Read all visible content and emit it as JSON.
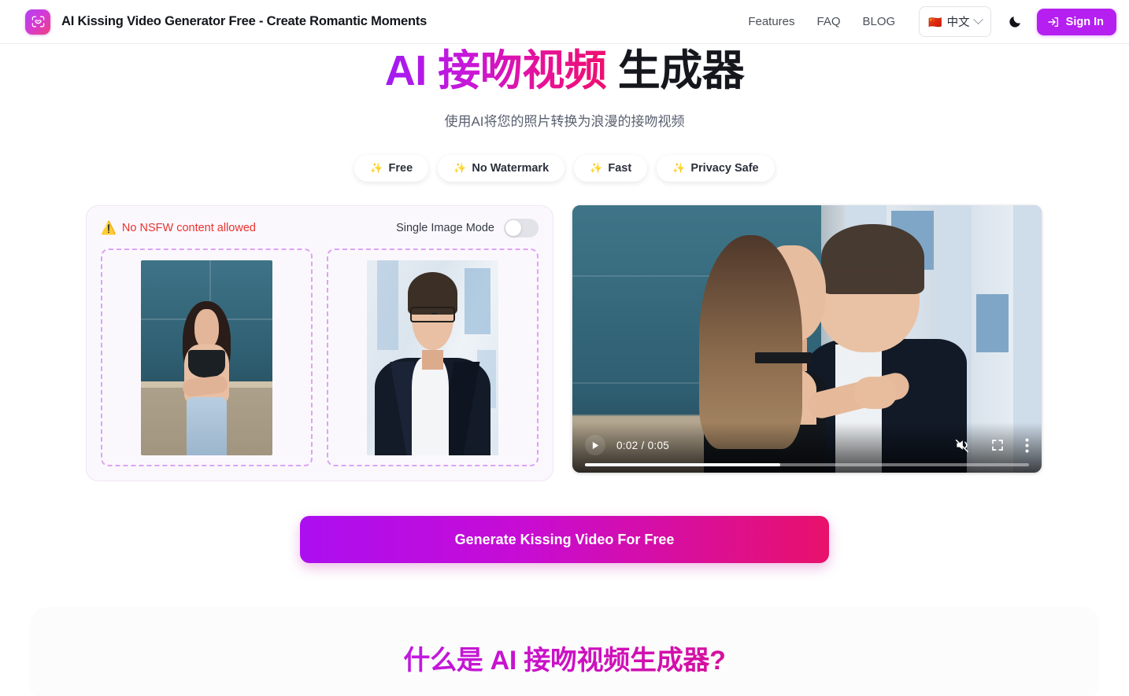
{
  "header": {
    "brand_title": "AI Kissing Video Generator Free - Create Romantic Moments",
    "logo_icon": "kiss-lips-frame-icon",
    "nav": [
      {
        "label": "Features"
      },
      {
        "label": "FAQ"
      },
      {
        "label": "BLOG"
      }
    ],
    "language": {
      "flag": "🇨🇳",
      "label": "中文",
      "chevron_icon": "chevron-down-icon"
    },
    "theme_toggle_icon": "moon-icon",
    "signin": {
      "label": "Sign In",
      "icon": "login-arrow-icon",
      "color": "#b51ff0"
    }
  },
  "hero": {
    "title_gradient": "AI 接吻视频",
    "title_plain": "生成器",
    "subtitle": "使用AI将您的照片转换为浪漫的接吻视频",
    "gradient_from": "#a21bf2",
    "gradient_to": "#ef0f6e",
    "pills": [
      {
        "icon": "✨",
        "label": "Free"
      },
      {
        "icon": "✨",
        "label": "No Watermark"
      },
      {
        "icon": "✨",
        "label": "Fast"
      },
      {
        "icon": "✨",
        "label": "Privacy Safe"
      }
    ]
  },
  "workspace": {
    "warning": {
      "icon": "⚠️",
      "text": "No NSFW content allowed",
      "color": "#e8342f"
    },
    "single_image_mode": {
      "label": "Single Image Mode",
      "enabled": false
    },
    "upload_slots": [
      {
        "name": "first-person-photo",
        "alt": "Woman standing in front of a teal wall",
        "filled": true
      },
      {
        "name": "second-person-photo",
        "alt": "Man with glasses in a dark suit",
        "filled": true
      }
    ]
  },
  "video": {
    "alt": "Generated kissing video of the two uploaded people",
    "play_icon": "play-icon",
    "current_time": "0:02",
    "duration": "0:05",
    "time_display": "0:02 / 0:05",
    "progress_percent": 44,
    "muted": true,
    "mute_icon": "muted-volume-icon",
    "fullscreen_icon": "fullscreen-icon",
    "more_icon": "kebab-menu-icon"
  },
  "cta": {
    "label": "Generate Kissing Video For Free",
    "gradient_from": "#ac0ef0",
    "gradient_to": "#e8116b"
  },
  "section2": {
    "title": "什么是 AI 接吻视频生成器?"
  }
}
